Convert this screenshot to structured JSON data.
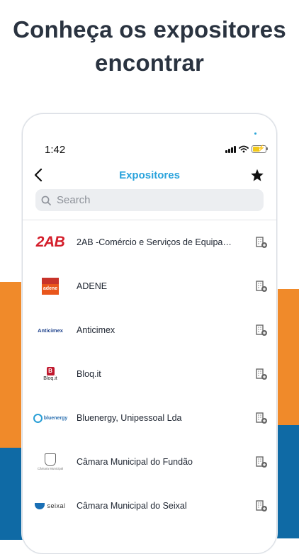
{
  "headline": {
    "line1": "Conheça os expositores",
    "line2": "encontrar"
  },
  "status_bar": {
    "time": "1:42"
  },
  "nav": {
    "title": "Expositores",
    "back_icon": "chevron-left-icon",
    "favorite_icon": "star-icon"
  },
  "search": {
    "placeholder": "Search",
    "value": ""
  },
  "exhibitors": [
    {
      "name": "2AB -Comércio e Serviços de Equipame...",
      "logo": "2AB"
    },
    {
      "name": "ADENE",
      "logo": "adene"
    },
    {
      "name": "Anticimex",
      "logo": "Anticimex"
    },
    {
      "name": "Bloq.it",
      "logo": "Bloq.it"
    },
    {
      "name": "Bluenergy, Unipessoal Lda",
      "logo": "bluenergy"
    },
    {
      "name": "Câmara Municipal do Fundão",
      "logo": "Câmara Municipal"
    },
    {
      "name": "Câmara Municipal do Seixal",
      "logo": "seixal"
    }
  ],
  "colors": {
    "accent": "#2aa3dc",
    "orange": "#f08a2a",
    "blue": "#0f6aa5",
    "text": "#2a3340"
  }
}
